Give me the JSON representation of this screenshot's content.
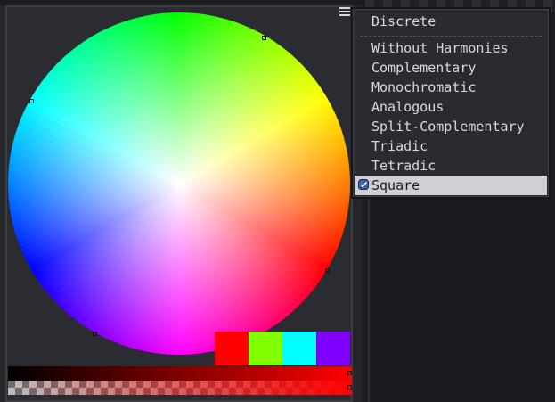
{
  "menu": {
    "title_item": "Discrete",
    "items": [
      "Without Harmonies",
      "Complementary",
      "Monochromatic",
      "Analogous",
      "Split-Complementary",
      "Triadic",
      "Tetradic",
      "Square"
    ],
    "selected": "Square"
  },
  "picker": {
    "options_icon": "hamburger-menu-icon",
    "swatch_colors": [
      "#ff0000",
      "#80ff00",
      "#00ffff",
      "#8000ff"
    ],
    "base_color": "#ff0000"
  },
  "icons": {
    "selected_indicator": "checked-radio-icon"
  }
}
